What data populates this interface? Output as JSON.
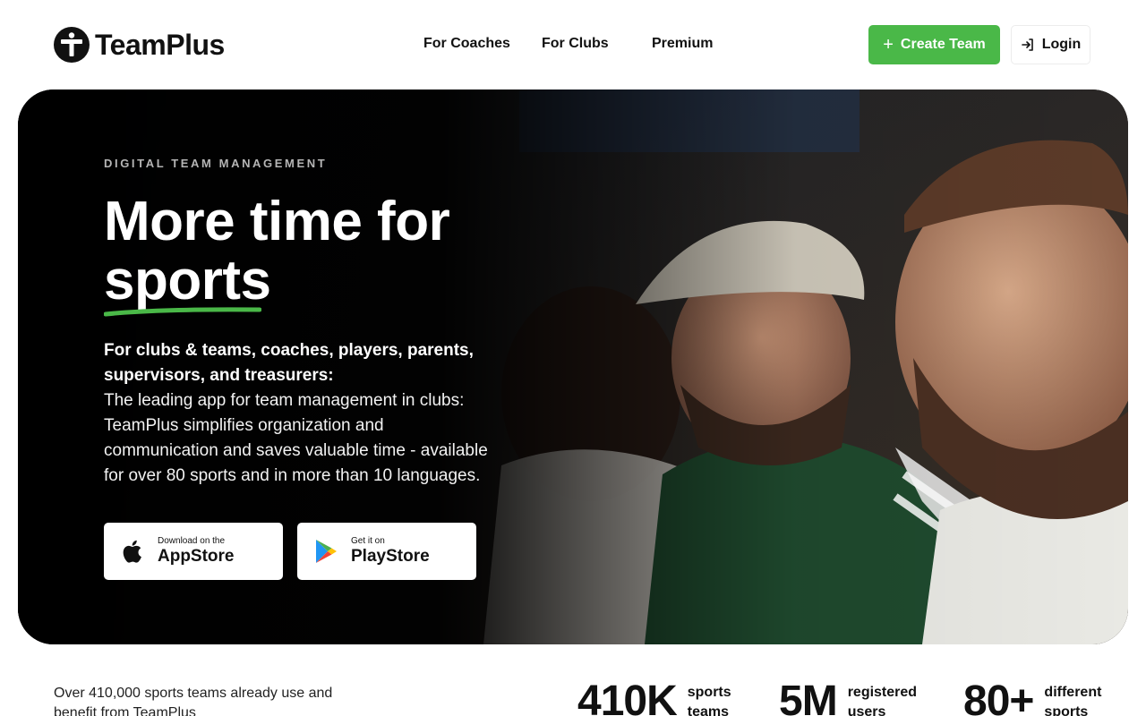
{
  "brand": {
    "name": "TeamPlus",
    "accent": "#4ab848"
  },
  "nav": {
    "items": [
      "For Coaches",
      "For Clubs",
      "Premium"
    ]
  },
  "header": {
    "create_label": "Create Team",
    "create_icon": "plus-icon",
    "login_label": "Login",
    "login_icon": "login-icon"
  },
  "hero": {
    "eyebrow": "DIGITAL TEAM MANAGEMENT",
    "headline_line1": "More time for",
    "headline_accent": "sports",
    "lead": "For clubs & teams, coaches, players, parents, supervisors, and treasurers:",
    "body": "The leading app for team management in clubs: TeamPlus simplifies organization and communication and saves valuable time - available for over 80 sports and in more than 10 languages.",
    "stores": [
      {
        "small": "Download on the",
        "big": "AppStore",
        "icon": "apple-icon"
      },
      {
        "small": "Get it on",
        "big": "PlayStore",
        "icon": "google-play-icon"
      }
    ]
  },
  "stats": {
    "intro": "Over 410,000 sports teams already use and benefit from TeamPlus",
    "items": [
      {
        "value": "410K",
        "label_line1": "sports",
        "label_line2": "teams"
      },
      {
        "value": "5M",
        "label_line1": "registered",
        "label_line2": "users"
      },
      {
        "value": "80+",
        "label_line1": "different",
        "label_line2": "sports"
      }
    ]
  }
}
